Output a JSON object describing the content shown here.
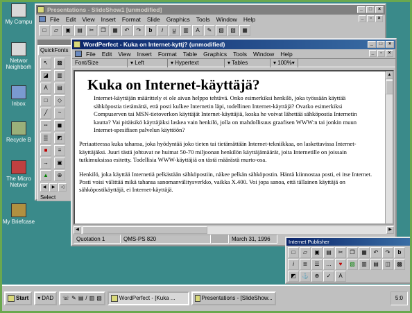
{
  "desktop": {
    "icons": [
      {
        "label": "My Compu"
      },
      {
        "label": "Networ Neighborh"
      },
      {
        "label": "Inbox"
      },
      {
        "label": "Recycle B"
      },
      {
        "label": "The Micro Networ"
      },
      {
        "label": "My Briefcase"
      }
    ]
  },
  "presentations_window": {
    "title": "Presentations - SlideShow1 [unmodified]",
    "menu": [
      "File",
      "Edit",
      "View",
      "Insert",
      "Format",
      "Slide",
      "Graphics",
      "Tools",
      "Window",
      "Help"
    ],
    "quickfonts_label": "QuickFonts",
    "select_label": "Select"
  },
  "wordperfect_window": {
    "title": "WordPerfect - Kuka on Internet-kyttj? (unmodified)",
    "menu": [
      "File",
      "Edit",
      "View",
      "Insert",
      "Format",
      "Table",
      "Graphics",
      "Tools",
      "Window",
      "Help"
    ],
    "propbar": [
      "Font/Size",
      "Left",
      "Hypertext",
      "Tables",
      "100%"
    ],
    "document": {
      "heading": "Kuka on Internet-käyttäjä?",
      "p1": "Internet-käyttäjän määrittely ei ole aivan helppo tehtävä. Onko esimerkiksi henkilö, joka työssään käyttää sähköpostia tietämättä, että posti kulkee Internetin läpi, todellinen Internet-käyttäjä? Ovatko esimerkiksi Compuserven tai MSN-tietoverkon käyttäjät Internet-käyttäjiä, koska he voivat lähettää sähköpostia Internetin kautta? Vai pitäisikö käyttäjäksi laskea vain henkilö, jolla on mahdollisuus graafisen WWW:n tai jonkin muun Internet-spesifisen palvelun käyttöön?",
      "p2": "Periaatteessa kuka tahansa, joka hyödyntää joko tieten tai tietämättään Internet-tekniikkaa, on laskettavissa Internet-käyttäjäksi. Juuri tästä johtuvat ne huimat 50-70 miljoonan henkilön käyttäjämäärät, joita Internetille on joissain tutkimuksissa esitetty. Todellisia WWW-käyttäjiä on tästä määrästä murto-osa.",
      "p3": "Henkilö, joka käyttää Internetiä pelkästään sähköpostiin, näkee pelkän sähköpostin. Häntä kiinnostaa posti, ei itse Internet. Posti voisi välittää mikä tahansa sanomanvälitysverkko, vaikka X.400. Voi jopa sanoa, että tällainen käyttäjä on sähköpostikäyttäjä, ei Internet-käyttäjä."
    },
    "status": {
      "style": "Quotation 1",
      "printer": "QMS-PS 820",
      "date": "March 31, 1996"
    }
  },
  "internet_publisher": {
    "title": "Internet Publisher"
  },
  "taskbar": {
    "start": "Start",
    "dad": "DAD",
    "task1": "WordPerfect - [Kuka ...",
    "task2": "Presentations - [SlideShow...",
    "clock": "5:0"
  }
}
